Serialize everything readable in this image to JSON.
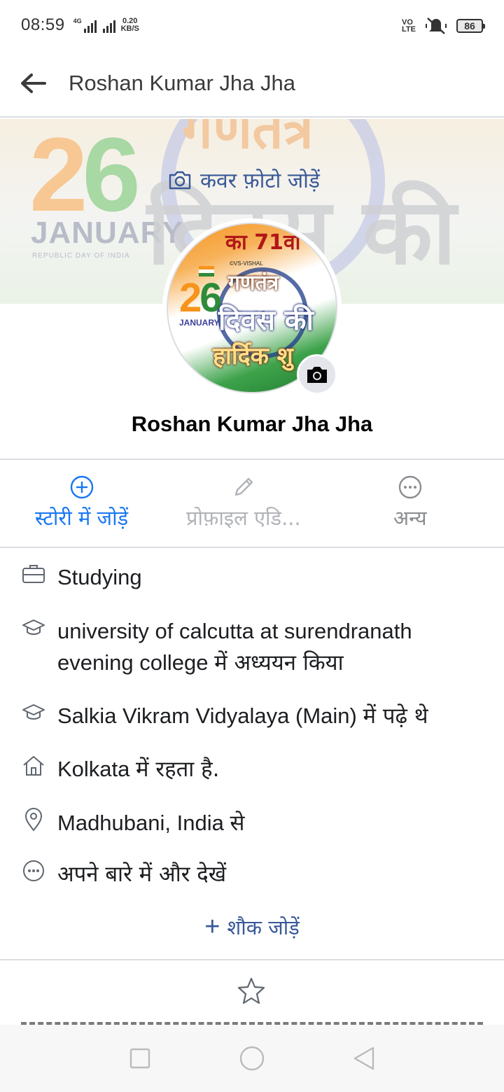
{
  "status_bar": {
    "time": "08:59",
    "network_label": "4G",
    "speed_value": "0.20",
    "speed_unit": "KB/S",
    "volte_top": "VO",
    "volte_bottom": "LTE",
    "battery": "86"
  },
  "header": {
    "title": "Roshan Kumar Jha Jha",
    "back_icon": "arrow-left-icon"
  },
  "cover": {
    "add_cover_label": "कवर फ़ोटो जोड़ें",
    "image": {
      "number": "26",
      "month": "JANUARY",
      "subtitle": "REPUBLIC DAY OF INDIA",
      "hindi_top": "गणतंत्र",
      "hindi_main": "दिवस की"
    }
  },
  "avatar": {
    "image": {
      "top_text": "का 71वां",
      "watermark": "©VS-VISHAL",
      "line1": "गणतंत्र",
      "line2": "दिवस की",
      "line3": "हार्दिक शु",
      "number": "26",
      "month": "JANUARY"
    },
    "camera_icon": "camera-icon"
  },
  "profile": {
    "name": "Roshan Kumar Jha Jha"
  },
  "actions": [
    {
      "label": "स्टोरी में जोड़ें",
      "icon": "plus-circle-icon",
      "color": "#1877f2"
    },
    {
      "label": "प्रोफ़ाइल एडि...",
      "icon": "pencil-icon",
      "color": "#b0b3b8"
    },
    {
      "label": "अन्य",
      "icon": "more-circle-icon",
      "color": "#8a8d91"
    }
  ],
  "info": {
    "work": {
      "text": "Studying",
      "icon": "briefcase-icon"
    },
    "college": {
      "text_en": "university of calcutta at surendranath evening college",
      "text_hi": "में अध्ययन किया",
      "icon": "graduation-cap-icon"
    },
    "school": {
      "text_en": "Salkia Vikram Vidyalaya (Main)",
      "text_hi": "में पढ़े थे",
      "icon": "graduation-cap-icon"
    },
    "lives": {
      "text_en": "Kolkata",
      "text_hi": "में रहता है.",
      "icon": "home-icon"
    },
    "from": {
      "text_en": "Madhubani, India",
      "text_hi": "से",
      "icon": "location-pin-icon"
    },
    "more": {
      "text": "अपने बारे में और देखें",
      "icon": "more-circle-icon"
    }
  },
  "hobby": {
    "plus": "+",
    "label": "शौक जोड़ें"
  },
  "featured": {
    "icon": "star-icon"
  },
  "nav": {
    "recent_icon": "square-icon",
    "home_icon": "circle-icon",
    "back_icon": "triangle-back-icon"
  }
}
